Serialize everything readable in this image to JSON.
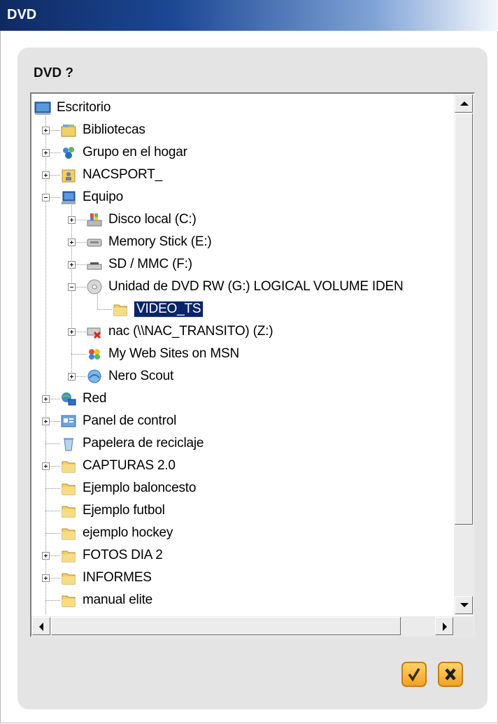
{
  "window": {
    "title": "DVD"
  },
  "dialog": {
    "prompt": "DVD ?"
  },
  "tree": {
    "nodes": [
      {
        "label": "Escritorio",
        "icon": "desktop-icon",
        "expanded": true
      },
      {
        "label": "Bibliotecas",
        "icon": "libraries-icon",
        "expanded": false
      },
      {
        "label": "Grupo en el hogar",
        "icon": "homegroup-icon",
        "expanded": false
      },
      {
        "label": "NACSPORT_",
        "icon": "user-folder-icon",
        "expanded": false
      },
      {
        "label": "Equipo",
        "icon": "computer-icon",
        "expanded": true
      },
      {
        "label": "Disco local (C:)",
        "icon": "hard-drive-icon",
        "expanded": false
      },
      {
        "label": "Memory Stick (E:)",
        "icon": "removable-drive-icon",
        "expanded": false
      },
      {
        "label": "SD / MMC (F:)",
        "icon": "card-reader-icon",
        "expanded": false
      },
      {
        "label": "Unidad de DVD RW (G:) LOGICAL VOLUME IDEN",
        "icon": "dvd-drive-icon",
        "expanded": true
      },
      {
        "label": "VIDEO_TS",
        "icon": "folder-icon",
        "selected": true
      },
      {
        "label": "nac (\\\\NAC_TRANSITO) (Z:)",
        "icon": "disconnected-network-drive-icon",
        "expanded": false
      },
      {
        "label": "My Web Sites on MSN",
        "icon": "msn-icon"
      },
      {
        "label": "Nero Scout",
        "icon": "nero-scout-icon",
        "expanded": false
      },
      {
        "label": "Red",
        "icon": "network-icon",
        "expanded": false
      },
      {
        "label": "Panel de control",
        "icon": "control-panel-icon",
        "expanded": false
      },
      {
        "label": "Papelera de reciclaje",
        "icon": "recycle-bin-icon"
      },
      {
        "label": "CAPTURAS 2.0",
        "icon": "folder-icon",
        "expanded": false
      },
      {
        "label": "Ejemplo baloncesto",
        "icon": "folder-icon"
      },
      {
        "label": "Ejemplo futbol",
        "icon": "folder-icon"
      },
      {
        "label": "ejemplo hockey",
        "icon": "folder-icon"
      },
      {
        "label": "FOTOS DIA 2",
        "icon": "folder-icon",
        "expanded": false
      },
      {
        "label": "INFORMES",
        "icon": "folder-icon",
        "expanded": false
      },
      {
        "label": "manual elite",
        "icon": "folder-icon"
      }
    ]
  },
  "buttons": {
    "ok": "check-icon",
    "cancel": "x-icon"
  },
  "colors": {
    "selection": "#0a246a",
    "button": "#f0a326",
    "panel": "#e4e4e4"
  }
}
